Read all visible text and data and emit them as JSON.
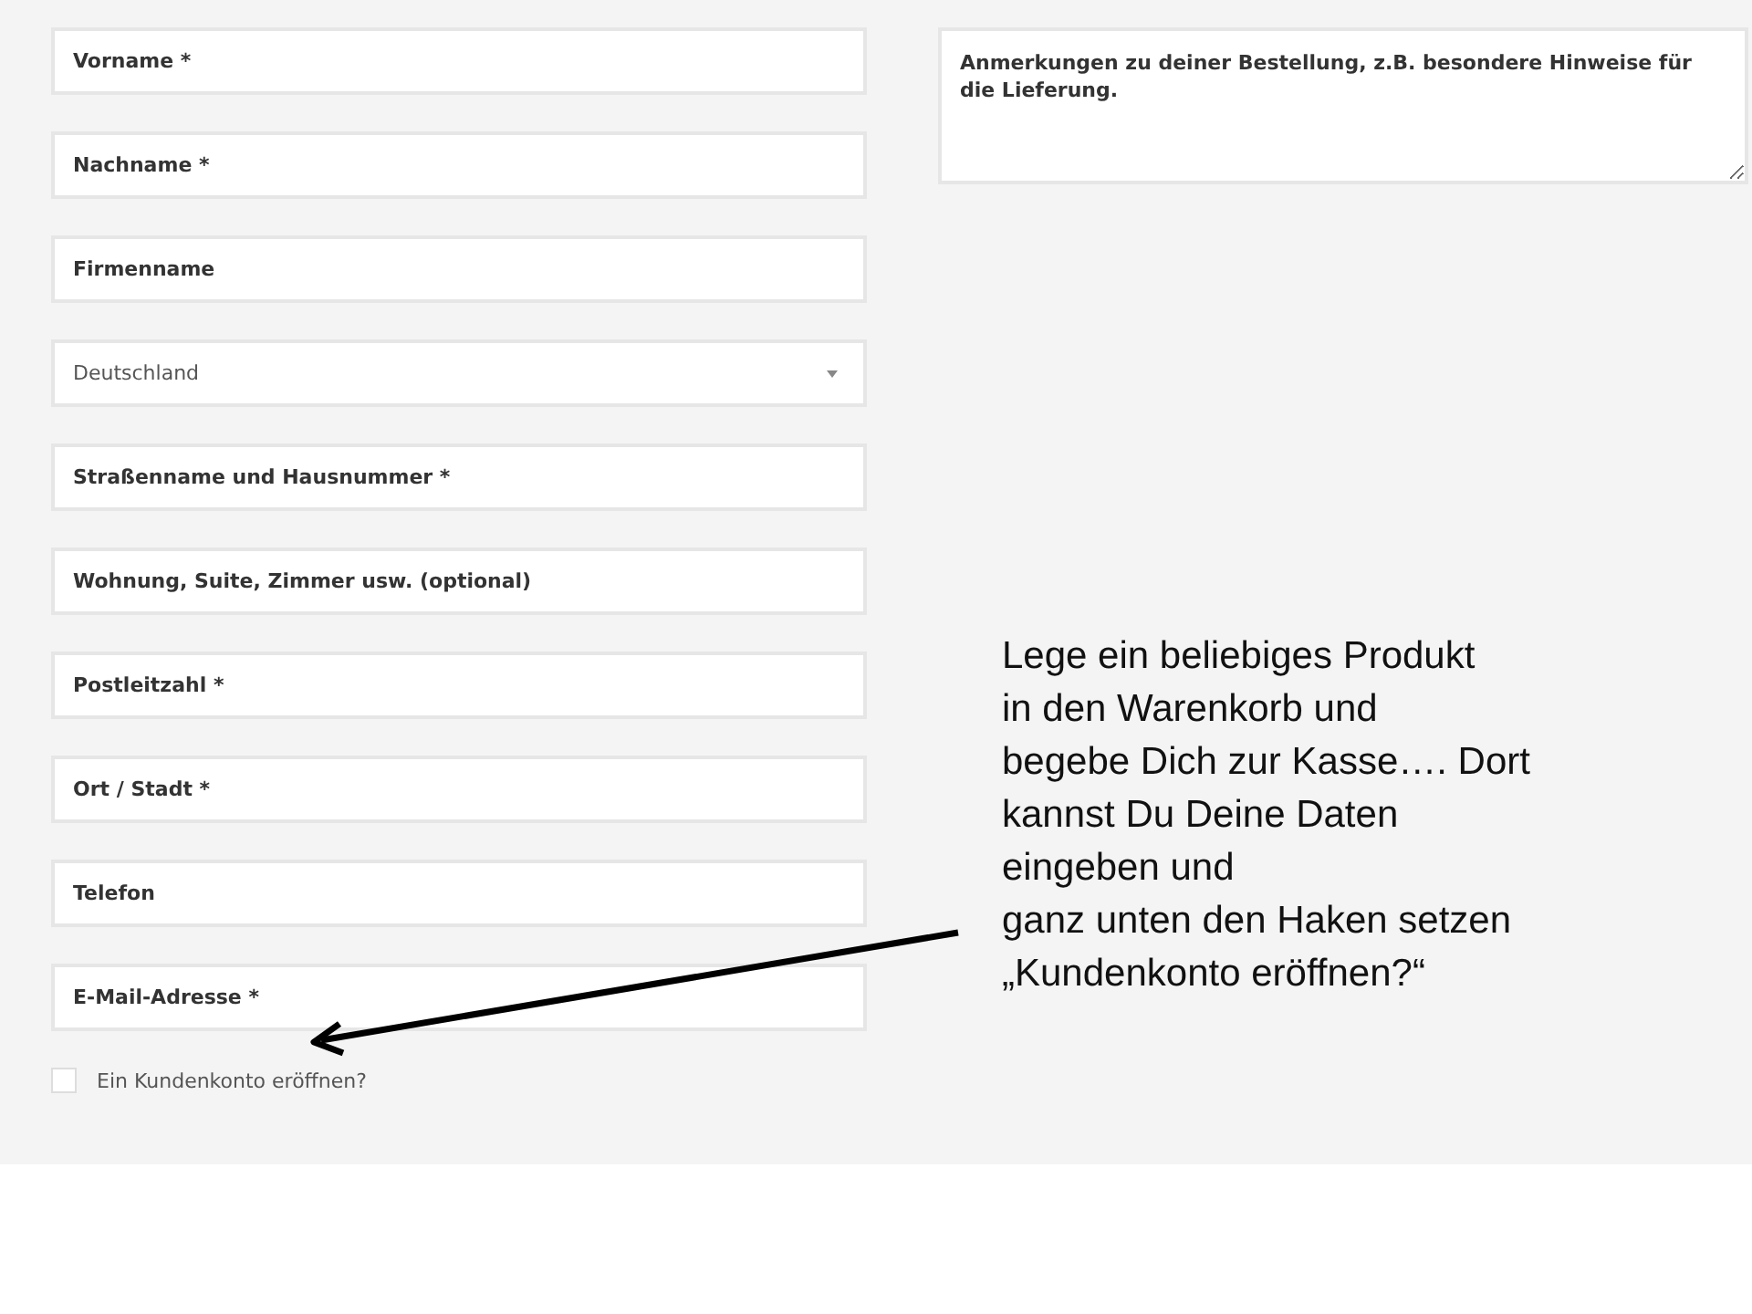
{
  "fields": [
    {
      "kind": "text",
      "placeholder": "Vorname *"
    },
    {
      "kind": "text",
      "placeholder": "Nachname *"
    },
    {
      "kind": "text",
      "placeholder": "Firmenname"
    },
    {
      "kind": "select",
      "value": "Deutschland"
    },
    {
      "kind": "text",
      "placeholder": "Straßenname und Hausnummer *"
    },
    {
      "kind": "text",
      "placeholder": "Wohnung, Suite, Zimmer usw. (optional)"
    },
    {
      "kind": "text",
      "placeholder": "Postleitzahl *"
    },
    {
      "kind": "text",
      "placeholder": "Ort / Stadt *"
    },
    {
      "kind": "text",
      "placeholder": "Telefon"
    },
    {
      "kind": "text",
      "placeholder": "E-Mail-Adresse *"
    }
  ],
  "create_account": {
    "label": "Ein Kundenkonto eröffnen?",
    "checked": false
  },
  "order_notes": {
    "placeholder": "Anmerkungen zu deiner Bestellung, z.B. besondere Hinweise für die Lieferung."
  },
  "annotation": {
    "lines": [
      "Lege ein beliebiges Produkt",
      "in den Warenkorb und",
      "begebe Dich zur Kasse…. Dort",
      "kannst Du Deine Daten",
      "eingeben und",
      "ganz unten den Haken setzen",
      "„Kundenkonto eröffnen?“"
    ]
  }
}
